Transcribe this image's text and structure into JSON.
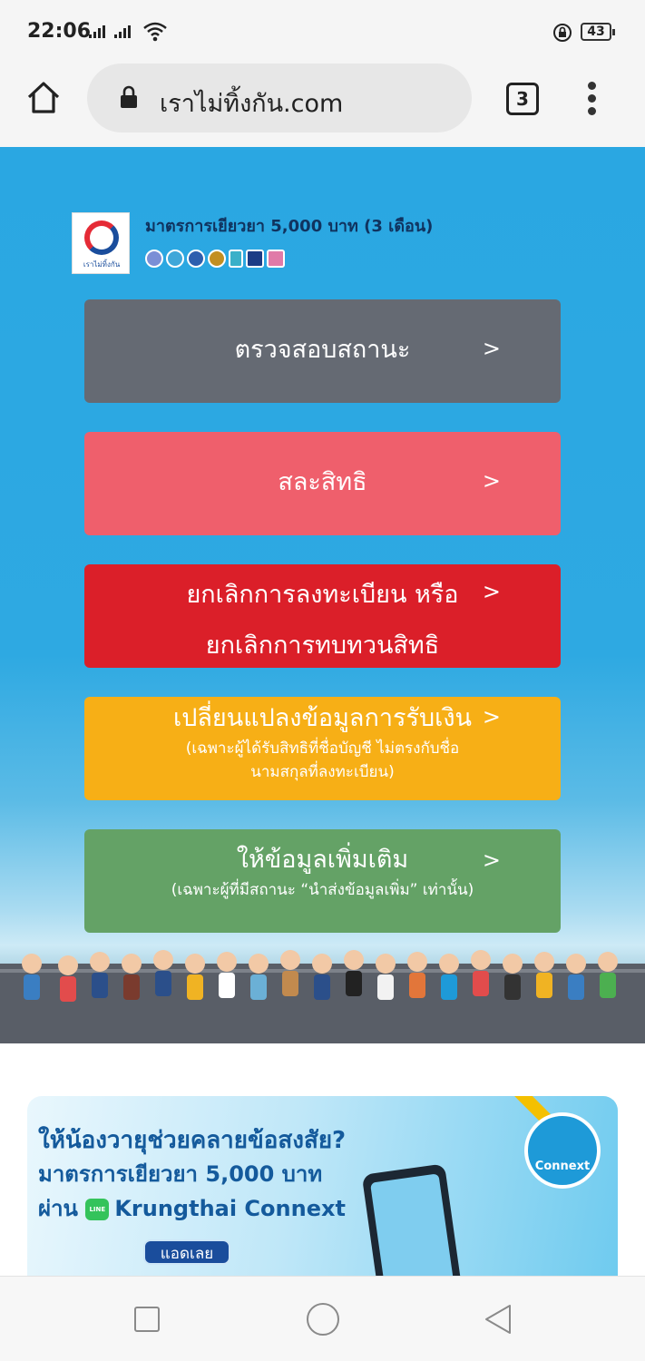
{
  "status_bar": {
    "time": "22:06",
    "battery": "43"
  },
  "browser": {
    "url": "เราไม่ทิ้งกัน.com",
    "tab_count": "3"
  },
  "header": {
    "logo_caption": "เราไม่ทิ้งกัน",
    "title": "มาตรการเยียวยา 5,000 บาท (3 เดือน)"
  },
  "actions": [
    {
      "main": "ตรวจสอบสถานะ",
      "chevron": ">",
      "color": "#656a73"
    },
    {
      "main": "สละสิทธิ",
      "chevron": ">",
      "color": "#ef5f6c"
    },
    {
      "main_line1": "ยกเลิกการลงทะเบียน หรือ",
      "main_line2": "ยกเลิกการทบทวนสิทธิ",
      "chevron": ">",
      "color": "#db1f29"
    },
    {
      "main": "เปลี่ยนแปลงข้อมูลการรับเงิน",
      "sub_line1": "(เฉพาะผู้ได้รับสิทธิที่ชื่อบัญชี ไม่ตรงกับชื่อ",
      "sub_line2": "นามสกุลที่ลงทะเบียน)",
      "chevron": ">",
      "color": "#f7af16"
    },
    {
      "main": "ให้ข้อมูลเพิ่มเติม",
      "sub": "(เฉพาะผู้ที่มีสถานะ “นำส่งข้อมูลเพิ่ม” เท่านั้น)",
      "chevron": ">",
      "color": "#64a266"
    }
  ],
  "banner": {
    "line1": "ให้น้องวายุช่วยคลายข้อสงสัย?",
    "line2": "มาตรการเยียวยา 5,000 บาท",
    "line3_prefix": "ผ่าน",
    "line_icon": "LINE",
    "line3_rest": "Krungthai Connext",
    "add_button": "แอดเลย",
    "badge": "Connext"
  }
}
